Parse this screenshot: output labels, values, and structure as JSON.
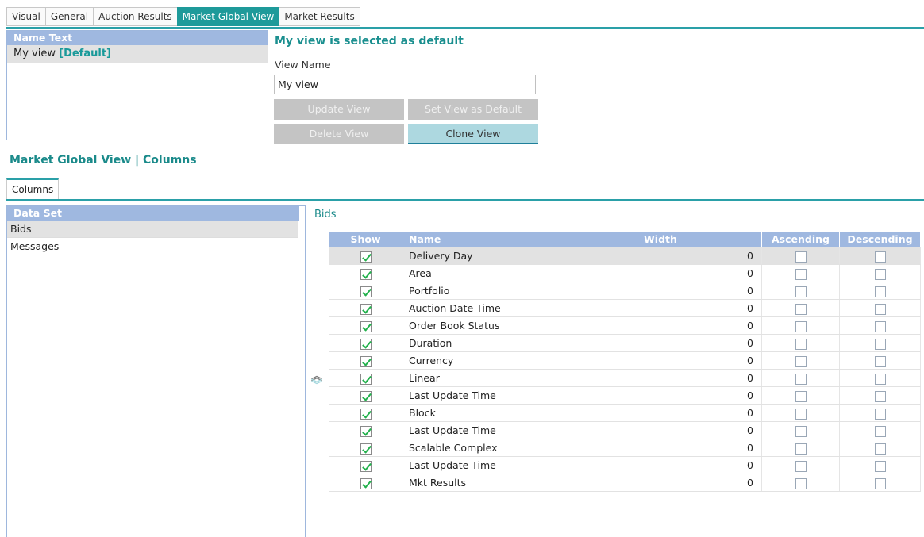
{
  "tabs": [
    "Visual",
    "General",
    "Auction Results",
    "Market Global View",
    "Market Results"
  ],
  "active_tab_index": 3,
  "views": {
    "header": "Name Text",
    "items": [
      {
        "name": "My view",
        "tag": "[Default]"
      }
    ]
  },
  "editor": {
    "status_title": "My view is selected as default",
    "view_name_label": "View Name",
    "view_name_value": "My view",
    "buttons": {
      "update": "Update View",
      "set_default": "Set View as Default",
      "delete": "Delete View",
      "clone": "Clone View"
    }
  },
  "section_title": "Market Global View | Columns",
  "subtab": "Columns",
  "dataset": {
    "header": "Data Set",
    "items": [
      "Bids",
      "Messages"
    ],
    "selected_index": 0
  },
  "grid": {
    "title": "Bids",
    "headers": {
      "show": "Show",
      "name": "Name",
      "width": "Width",
      "ascending": "Ascending",
      "descending": "Descending"
    },
    "rows": [
      {
        "name": "Delivery Day",
        "width": "0"
      },
      {
        "name": "Area",
        "width": "0"
      },
      {
        "name": "Portfolio",
        "width": "0"
      },
      {
        "name": "Auction Date Time",
        "width": "0"
      },
      {
        "name": "Order Book Status",
        "width": "0"
      },
      {
        "name": "Duration",
        "width": "0"
      },
      {
        "name": "Currency",
        "width": "0"
      },
      {
        "name": "Linear",
        "width": "0"
      },
      {
        "name": "Last Update Time",
        "width": "0"
      },
      {
        "name": "Block",
        "width": "0"
      },
      {
        "name": "Last Update Time",
        "width": "0"
      },
      {
        "name": "Scalable Complex",
        "width": "0"
      },
      {
        "name": "Last Update Time",
        "width": "0"
      },
      {
        "name": "Mkt Results",
        "width": "0"
      }
    ]
  },
  "icons": {
    "move_up": "double-chevron-up-icon",
    "move_down": "double-chevron-down-icon"
  },
  "colors": {
    "accent": "#1e9a9a",
    "header_blue": "#9fb8e0",
    "check_green": "#22b14c"
  }
}
